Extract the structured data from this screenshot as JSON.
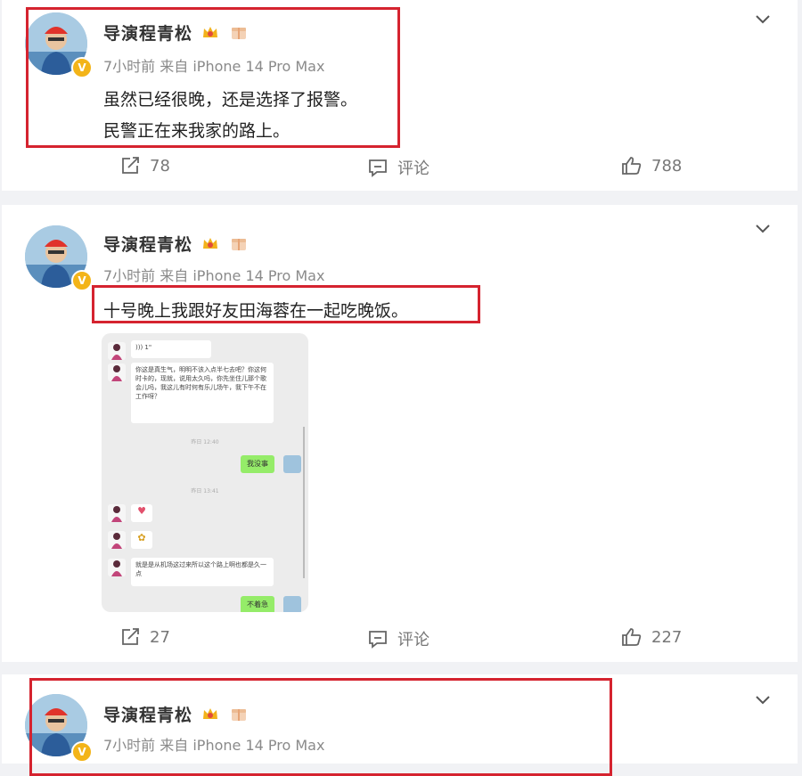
{
  "colors": {
    "highlight": "#d5232f",
    "meta": "#8a8a8a",
    "verified": "#f3b419"
  },
  "posts": [
    {
      "author": "导演程青松",
      "meta": "7小时前 来自 iPhone 14 Pro Max",
      "lines": [
        "虽然已经很晚，还是选择了报警。",
        "民警正在来我家的路上。"
      ],
      "repost": "78",
      "comment": "评论",
      "like": "788"
    },
    {
      "author": "导演程青松",
      "meta": "7小时前 来自 iPhone 14 Pro Max",
      "lines": [
        "十号晚上我跟好友田海蓉在一起吃晚饭。"
      ],
      "repost": "27",
      "comment": "评论",
      "like": "227",
      "chat": {
        "voice": "))) 1\"",
        "message1": "你这是真生气，明明不该入点半七去吧？你这何时卡的，现就，说用太久吗，你先坐住儿那个歌会儿吗，我这儿有时何有乐儿场午，我下午不在工作呀？",
        "time1": "昨日 12:40",
        "reply1": "我没事",
        "time2": "昨日 13:41",
        "message2": "就是是从机场这过来所以这个路上啊也都是久一点",
        "reply2": "不着急",
        "heart": "♥",
        "flower": "✿"
      }
    },
    {
      "author": "导演程青松",
      "meta": "7小时前 来自 iPhone 14 Pro Max"
    }
  ],
  "icons": {
    "verified": "V",
    "crown": "crown-icon",
    "gift": "gift-icon",
    "more": "chevron-down-icon",
    "repost": "share-icon",
    "comment": "comment-icon",
    "like": "thumb-up-icon"
  }
}
